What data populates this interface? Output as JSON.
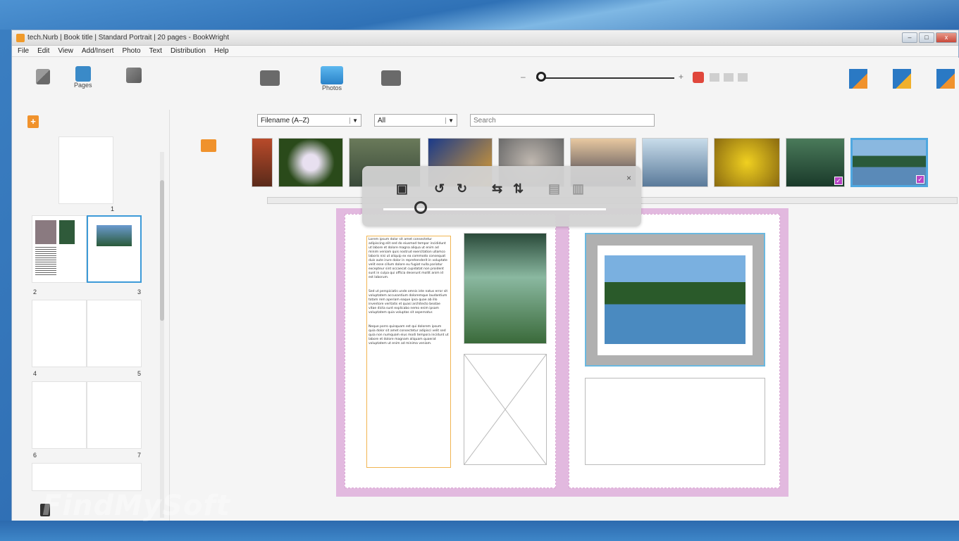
{
  "window": {
    "title": "tech.Nurb | Book title | Standard Portrait | 20 pages - BookWright",
    "buttons": {
      "minimize": "–",
      "maximize": "□",
      "close": "x"
    }
  },
  "menu": [
    "File",
    "Edit",
    "View",
    "Add/Insert",
    "Photo",
    "Text",
    "Distribution",
    "Help"
  ],
  "left_tabs": {
    "pages_label": "Pages"
  },
  "center_tabs": {
    "photos_label": "Photos"
  },
  "zoom": {
    "minus": "–",
    "plus": "+"
  },
  "filters": {
    "sort_value": "Filename (A–Z)",
    "show_value": "All",
    "search_placeholder": "Search"
  },
  "pages": {
    "numbers": [
      "1",
      "2",
      "3",
      "4",
      "5",
      "6",
      "7"
    ]
  },
  "overlay": {
    "close": "×",
    "buttons": [
      "▣",
      "↺",
      "↻",
      "⇆",
      "⇅",
      "▤",
      "▥"
    ]
  },
  "watermark": "FindMySoft"
}
